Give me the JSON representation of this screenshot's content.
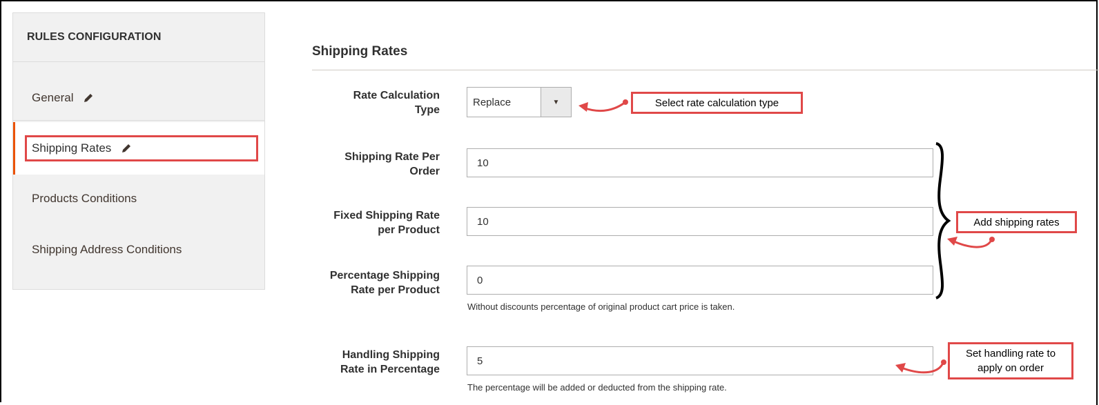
{
  "sidebar": {
    "title": "RULES CONFIGURATION",
    "items": [
      {
        "label": "General",
        "icon": "pencil-icon"
      },
      {
        "label": "Shipping Rates",
        "icon": "pencil-icon",
        "active": true
      },
      {
        "label": "Products Conditions"
      },
      {
        "label": "Shipping Address Conditions"
      }
    ]
  },
  "section": {
    "title": "Shipping Rates"
  },
  "fields": {
    "rate_calc": {
      "label_line1": "Rate Calculation",
      "label_line2": "Type",
      "value": "Replace"
    },
    "rate_per_order": {
      "label_line1": "Shipping Rate Per",
      "label_line2": "Order",
      "value": "10"
    },
    "fixed_rate": {
      "label_line1": "Fixed Shipping Rate",
      "label_line2": "per Product",
      "value": "10"
    },
    "percentage_rate": {
      "label_line1": "Percentage Shipping",
      "label_line2": "Rate per Product",
      "value": "0",
      "note": "Without discounts percentage of original product cart price is taken."
    },
    "handling_rate": {
      "label_line1": "Handling Shipping",
      "label_line2": "Rate in Percentage",
      "value": "5",
      "note": "The percentage will be added or deducted from the shipping rate."
    }
  },
  "callouts": {
    "select_type": "Select rate calculation type",
    "add_rates": "Add shipping rates",
    "handling_line1": "Set handling rate to",
    "handling_line2": "apply on order"
  },
  "colors": {
    "accent": "#eb5202",
    "callout": "#e04848"
  }
}
